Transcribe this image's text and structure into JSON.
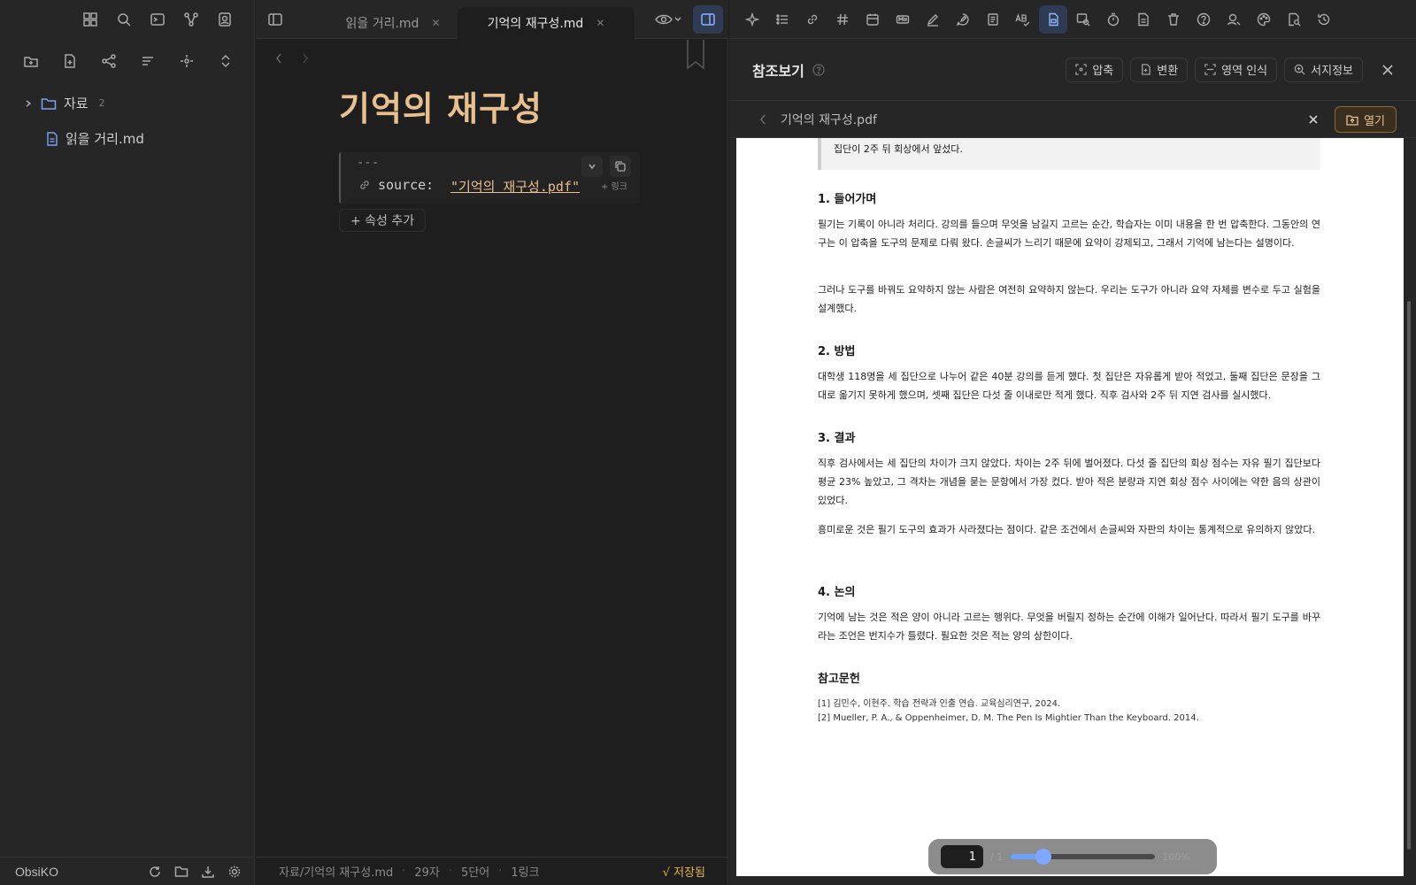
{
  "left_sidebar": {
    "ribbon_icons": [
      "dashboard-icon",
      "search-icon",
      "terminal-icon",
      "graph-icon",
      "profile-icon"
    ],
    "toolbar_icons": [
      "new-folder-icon",
      "new-note-icon",
      "graph-nodes-icon",
      "sort-icon",
      "focus-icon",
      "collapse-icon"
    ],
    "tree": [
      {
        "label": "자료",
        "count": "2",
        "type": "folder"
      },
      {
        "label": "읽을 거리.md",
        "type": "file"
      }
    ],
    "vault_name": "ObsiKO"
  },
  "editor": {
    "tabs": [
      {
        "label": "읽을 거리.md",
        "active": false
      },
      {
        "label": "기억의 재구성.md",
        "active": true
      }
    ],
    "title": "기억의 재구성",
    "frontmatter_dashes": "---",
    "property_key": "source:",
    "property_value": "\"기억의 재구성.pdf\"",
    "link_hint": "+ 링크",
    "add_property": "+ 속성 추가",
    "status": {
      "path": "자료/기억의 재구성.md",
      "chars": "29자",
      "words": "5단어",
      "links": "1링크",
      "saved": "√ 저장됨"
    }
  },
  "right_panel": {
    "title": "참조보기",
    "buttons": [
      "압축",
      "변환",
      "영역 인식",
      "서지정보"
    ],
    "file_name": "기억의 재구성.pdf",
    "open_label": "열기"
  },
  "pdf": {
    "quote": "집단이 2주 뒤 회상에서 앞섰다.",
    "sections": [
      {
        "heading": "1. 들어가며",
        "paras": [
          "필기는 기록이 아니라 처리다. 강의를 들으며 무엇을 남길지 고르는 순간, 학습자는 이미 내용을 한 번 압축한다. 그동안의 연구는 이 압축을 도구의 문제로 다뤄 왔다. 손글씨가 느리기 때문에 요약이 강제되고, 그래서 기억에 남는다는 설명이다.",
          "그러나 도구를 바꿔도 요약하지 않는 사람은 여전히 요약하지 않는다. 우리는 도구가 아니라 요약 자체를 변수로 두고 실험을 설계했다."
        ]
      },
      {
        "heading": "2. 방법",
        "paras": [
          "대학생 118명을 세 집단으로 나누어 같은 40분 강의를 듣게 했다. 첫 집단은 자유롭게 받아 적었고, 둘째 집단은 문장을 그대로 옮기지 못하게 했으며, 셋째 집단은 다섯 줄 이내로만 적게 했다. 직후 검사와 2주 뒤 지연 검사를 실시했다."
        ]
      },
      {
        "heading": "3. 결과",
        "paras": [
          "직후 검사에서는 세 집단의 차이가 크지 않았다. 차이는 2주 뒤에 벌어졌다. 다섯 줄 집단의 회상 점수는 자유 필기 집단보다 평균 23% 높았고, 그 격차는 개념을 묻는 문항에서 가장 컸다. 받아 적은 분량과 지연 회상 점수 사이에는 약한 음의 상관이 있었다.",
          "흥미로운 것은 필기 도구의 효과가 사라졌다는 점이다. 같은 조건에서 손글씨와 자판의 차이는 통계적으로 유의하지 않았다."
        ]
      },
      {
        "heading": "4. 논의",
        "paras": [
          "기억에 남는 것은 적은 양이 아니라 고르는 행위다. 무엇을 버릴지 정하는 순간에 이해가 일어난다. 따라서 필기 도구를 바꾸라는 조언은 번지수가 틀렸다. 필요한 것은 적는 양의 상한이다."
        ]
      }
    ],
    "refs_heading": "참고문헌",
    "refs": [
      "[1] 김민수, 이현주. 학습 전략과 인출 연습. 교육심리연구, 2024.",
      "[2] Mueller, P. A., & Oppenheimer, D. M. The Pen Is Mightier Than the Keyboard. 2014."
    ]
  },
  "pager": {
    "page": "1",
    "total": "/ 1",
    "zoom": "100%",
    "zoom_fraction": 0.23
  }
}
